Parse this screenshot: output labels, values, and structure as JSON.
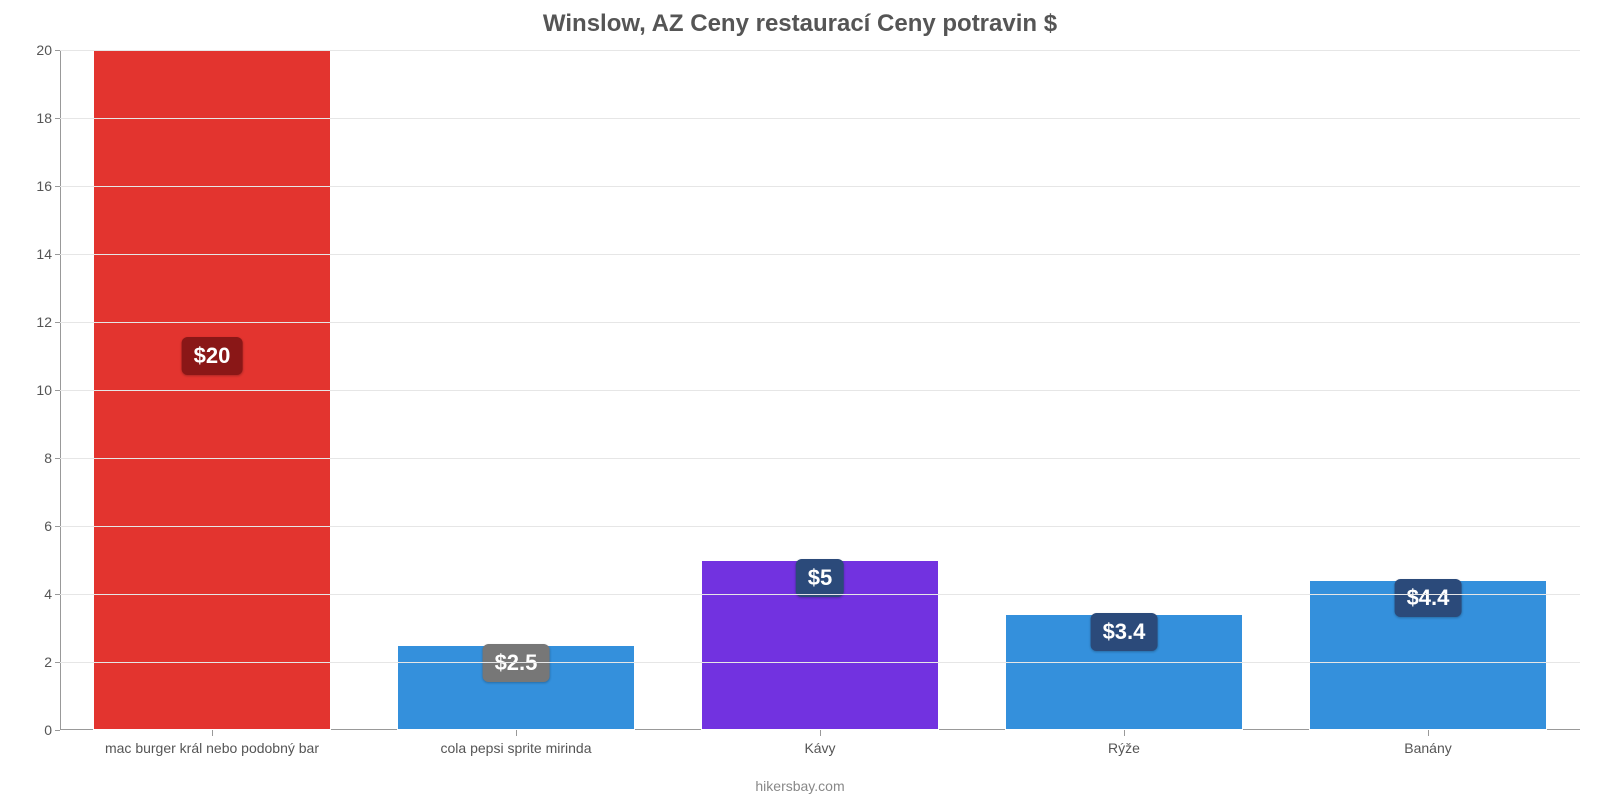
{
  "chart_data": {
    "type": "bar",
    "title": "Winslow, AZ Ceny restaurací Ceny potravin $",
    "credit": "hikersbay.com",
    "ylim": [
      0,
      20
    ],
    "y_ticks": [
      0,
      2,
      4,
      6,
      8,
      10,
      12,
      14,
      16,
      18,
      20
    ],
    "categories": [
      "mac burger král nebo podobný bar",
      "cola pepsi sprite mirinda",
      "Kávy",
      "Rýže",
      "Banány"
    ],
    "values": [
      20,
      2.5,
      5,
      3.4,
      4.4
    ],
    "value_labels": [
      "$20",
      "$2.5",
      "$5",
      "$3.4",
      "$4.4"
    ],
    "bar_colors": [
      "#e3342f",
      "#3490dc",
      "#7232e0",
      "#3490dc",
      "#3490dc"
    ],
    "badge_colors": [
      "#8a1717",
      "#777777",
      "#2b4a7a",
      "#2b4a7a",
      "#2b4a7a"
    ]
  }
}
